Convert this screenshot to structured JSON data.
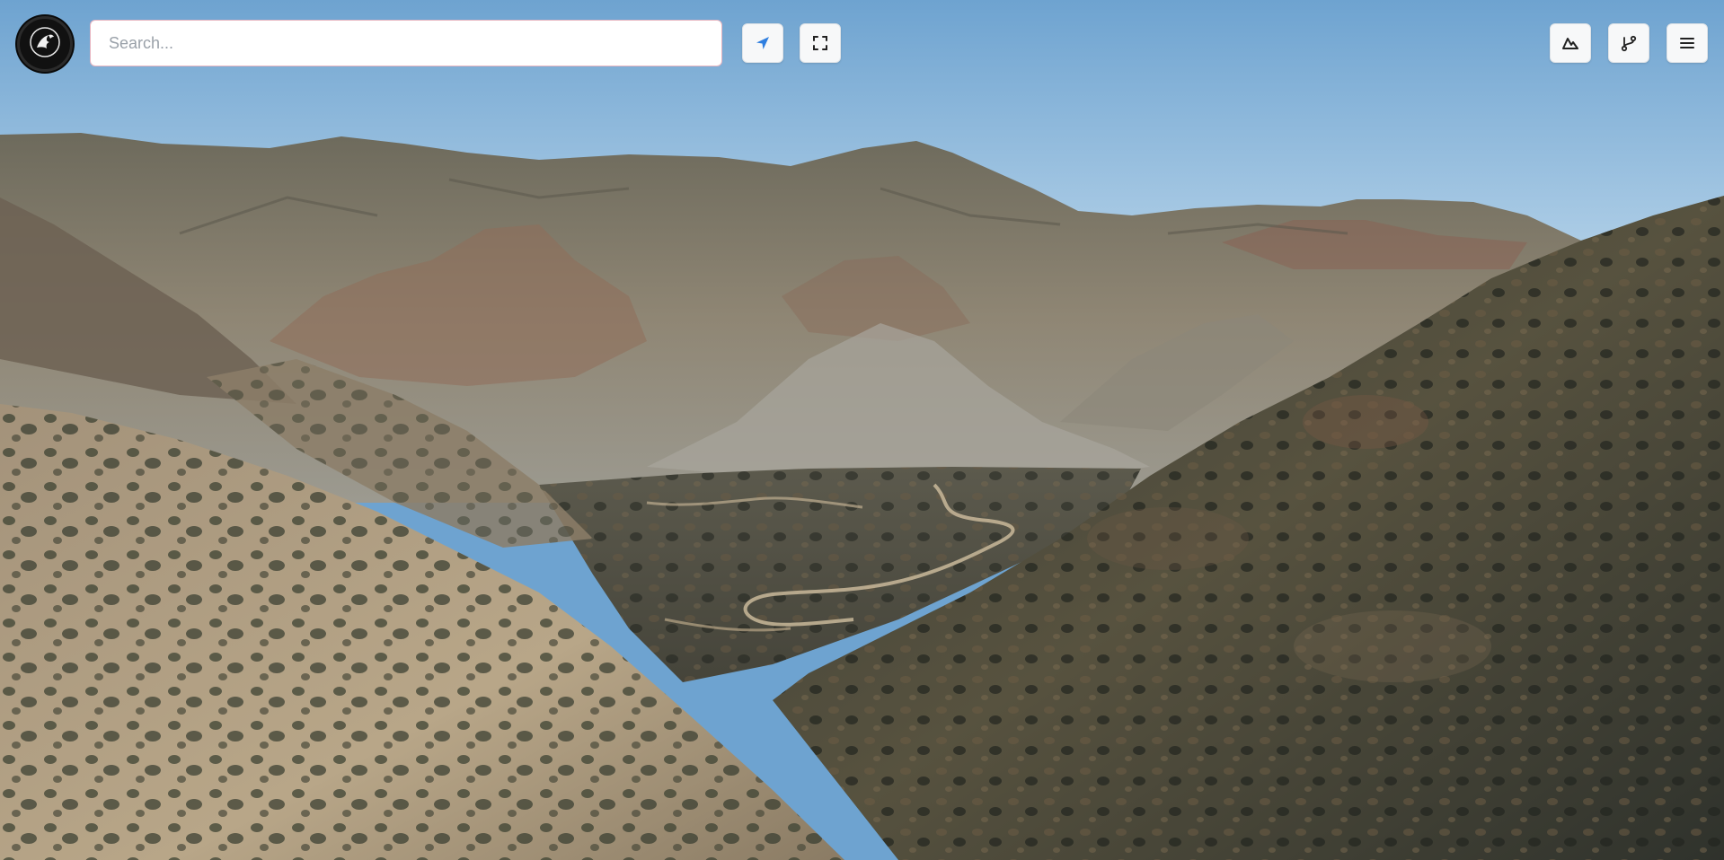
{
  "toolbar": {
    "search": {
      "placeholder": "Search...",
      "value": ""
    },
    "left_buttons": [
      {
        "name": "locate",
        "icon": "navigation-arrow-icon",
        "color": "#2f7fe0"
      },
      {
        "name": "fullscreen",
        "icon": "fullscreen-icon"
      }
    ],
    "right_buttons": [
      {
        "name": "terrain",
        "icon": "mountain-icon"
      },
      {
        "name": "route",
        "icon": "route-branch-icon"
      },
      {
        "name": "menu",
        "icon": "hamburger-menu-icon"
      }
    ]
  },
  "logo": {
    "icon": "phoenix-bird-icon"
  },
  "scene": {
    "type": "3d-terrain-satellite",
    "colors": {
      "sky_top": "#6ea3d0",
      "sky_bottom": "#b3d1e8",
      "ridge": "#7d7868",
      "valley": "#4f4c40",
      "slope_light": "#b9a688",
      "slope_dark": "#3b3f38"
    }
  }
}
